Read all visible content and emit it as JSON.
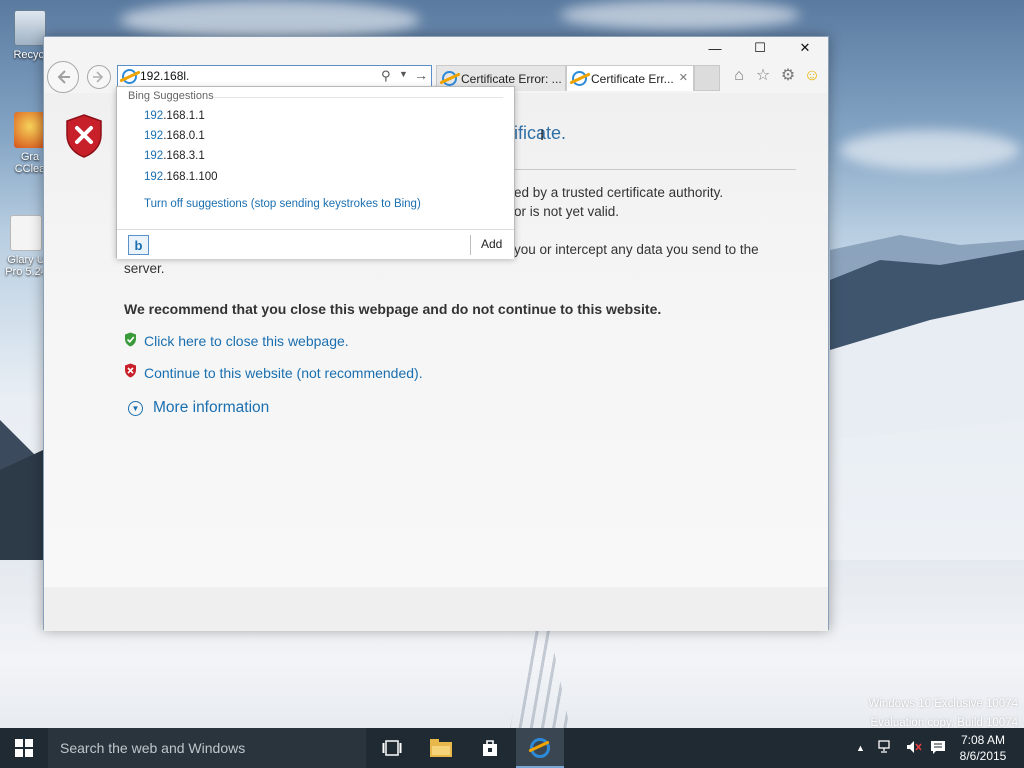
{
  "desktop": {
    "icons": [
      {
        "label": "Recycl"
      },
      {
        "label": "Gra\nCClea"
      },
      {
        "label": "Glary U\nPro 5.24"
      }
    ],
    "watermark_line1": "Windows 10 Exclusive 10074",
    "watermark_line2": "Evaluation copy. Build 10074"
  },
  "window": {
    "controls": {
      "minimize": "—",
      "maximize": "☐",
      "close": "✕"
    },
    "address_value": "192.168l.",
    "tabs": [
      {
        "label": "Certificate Error: ...",
        "active": false
      },
      {
        "label": "Certificate Err...",
        "active": true
      }
    ],
    "tab_close": "✕"
  },
  "suggestions": {
    "header": "Bing Suggestions",
    "items": [
      {
        "prefix": "192",
        "rest": ".168.1.1"
      },
      {
        "prefix": "192",
        "rest": ".168.0.1"
      },
      {
        "prefix": "192",
        "rest": ".168.3.1"
      },
      {
        "prefix": "192",
        "rest": ".168.1.100"
      }
    ],
    "turn_off": "Turn off suggestions (stop sending keystrokes to Bing)",
    "add_label": "Add",
    "bing_glyph": "b"
  },
  "page": {
    "title_visible": "ificate.",
    "line1": "ed by a trusted certificate authority.",
    "line2": "or is not yet valid.",
    "line3": "you or intercept any data you send to the",
    "line4": "server.",
    "recommend": "We recommend that you close this webpage and do not continue to this website.",
    "close_link": "Click here to close this webpage.",
    "continue_link": "Continue to this website (not recommended).",
    "more_info": "More information"
  },
  "taskbar": {
    "search_placeholder": "Search the web and Windows",
    "time": "7:08 AM",
    "date": "8/6/2015"
  },
  "colors": {
    "link": "#1a6fb0",
    "taskbar": "#1f2a33",
    "error_red": "#c8202a",
    "safe_green": "#3a9a3a"
  }
}
